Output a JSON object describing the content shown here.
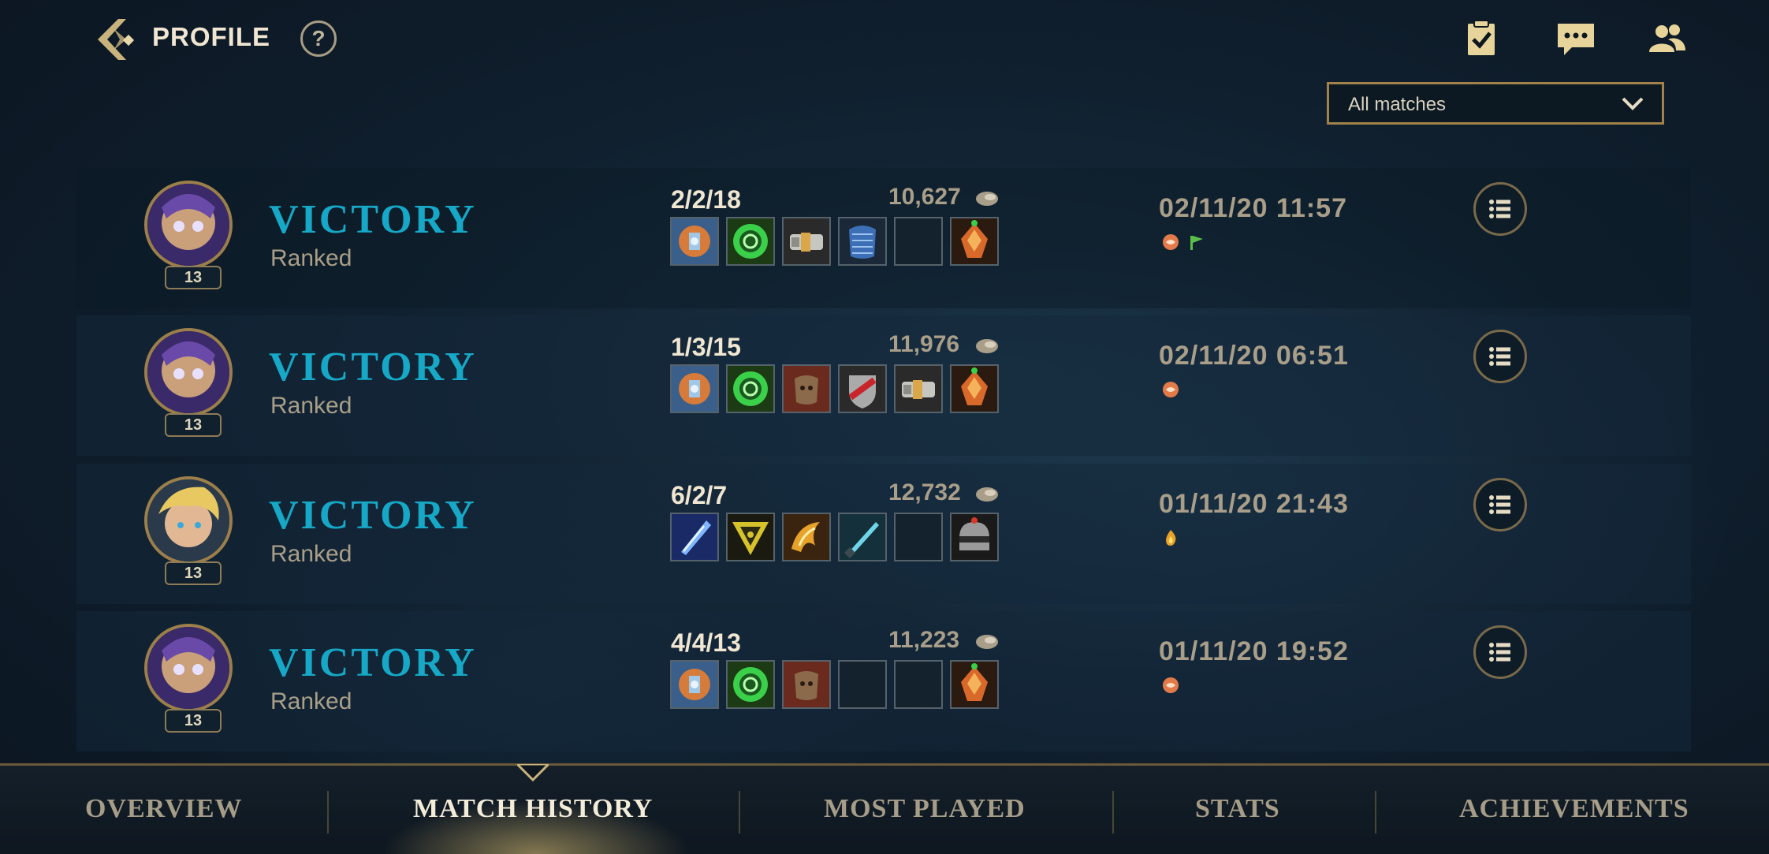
{
  "header": {
    "title": "PROFILE",
    "help_label": "?",
    "icons": [
      "missions-icon",
      "chat-icon",
      "friends-icon"
    ]
  },
  "filter": {
    "selected": "All matches"
  },
  "matches": [
    {
      "result": "VICTORY",
      "queue": "Ranked",
      "level": "13",
      "champion": "purple",
      "kda": "2/2/18",
      "gold": "10,627",
      "date": "02/11/20 11:57",
      "items": [
        "orange-blue",
        "green-ring",
        "silver-gauntlet",
        "blue-chainmail",
        "empty",
        "orange-ward"
      ],
      "badges": [
        "mvp-badge",
        "flag-badge"
      ]
    },
    {
      "result": "VICTORY",
      "queue": "Ranked",
      "level": "13",
      "champion": "purple",
      "kda": "1/3/15",
      "gold": "11,976",
      "date": "02/11/20 06:51",
      "items": [
        "orange-blue",
        "green-ring",
        "brown-armor",
        "red-shield",
        "silver-gauntlet",
        "orange-ward"
      ],
      "badges": [
        "mvp-badge"
      ]
    },
    {
      "result": "VICTORY",
      "queue": "Ranked",
      "level": "13",
      "champion": "blonde",
      "kda": "6/2/7",
      "gold": "12,732",
      "date": "01/11/20 21:43",
      "items": [
        "blue-blade",
        "gold-triangle",
        "gold-claw",
        "cyan-sword",
        "empty",
        "dark-helm"
      ],
      "badges": [
        "fire-badge"
      ]
    },
    {
      "result": "VICTORY",
      "queue": "Ranked",
      "level": "13",
      "champion": "purple",
      "kda": "4/4/13",
      "gold": "11,223",
      "date": "01/11/20 19:52",
      "items": [
        "orange-blue",
        "green-ring",
        "brown-armor",
        "empty",
        "empty",
        "orange-ward"
      ],
      "badges": [
        "mvp-badge"
      ]
    }
  ],
  "tabs": [
    {
      "label": "OVERVIEW",
      "active": false
    },
    {
      "label": "MATCH HISTORY",
      "active": true
    },
    {
      "label": "MOST PLAYED",
      "active": false
    },
    {
      "label": "STATS",
      "active": false
    },
    {
      "label": "ACHIEVEMENTS",
      "active": false
    }
  ],
  "colors": {
    "victory": "#16a8c6",
    "gold_accent": "#a2824a",
    "text_light": "#f0e6d2",
    "text_muted": "#a89e89"
  }
}
